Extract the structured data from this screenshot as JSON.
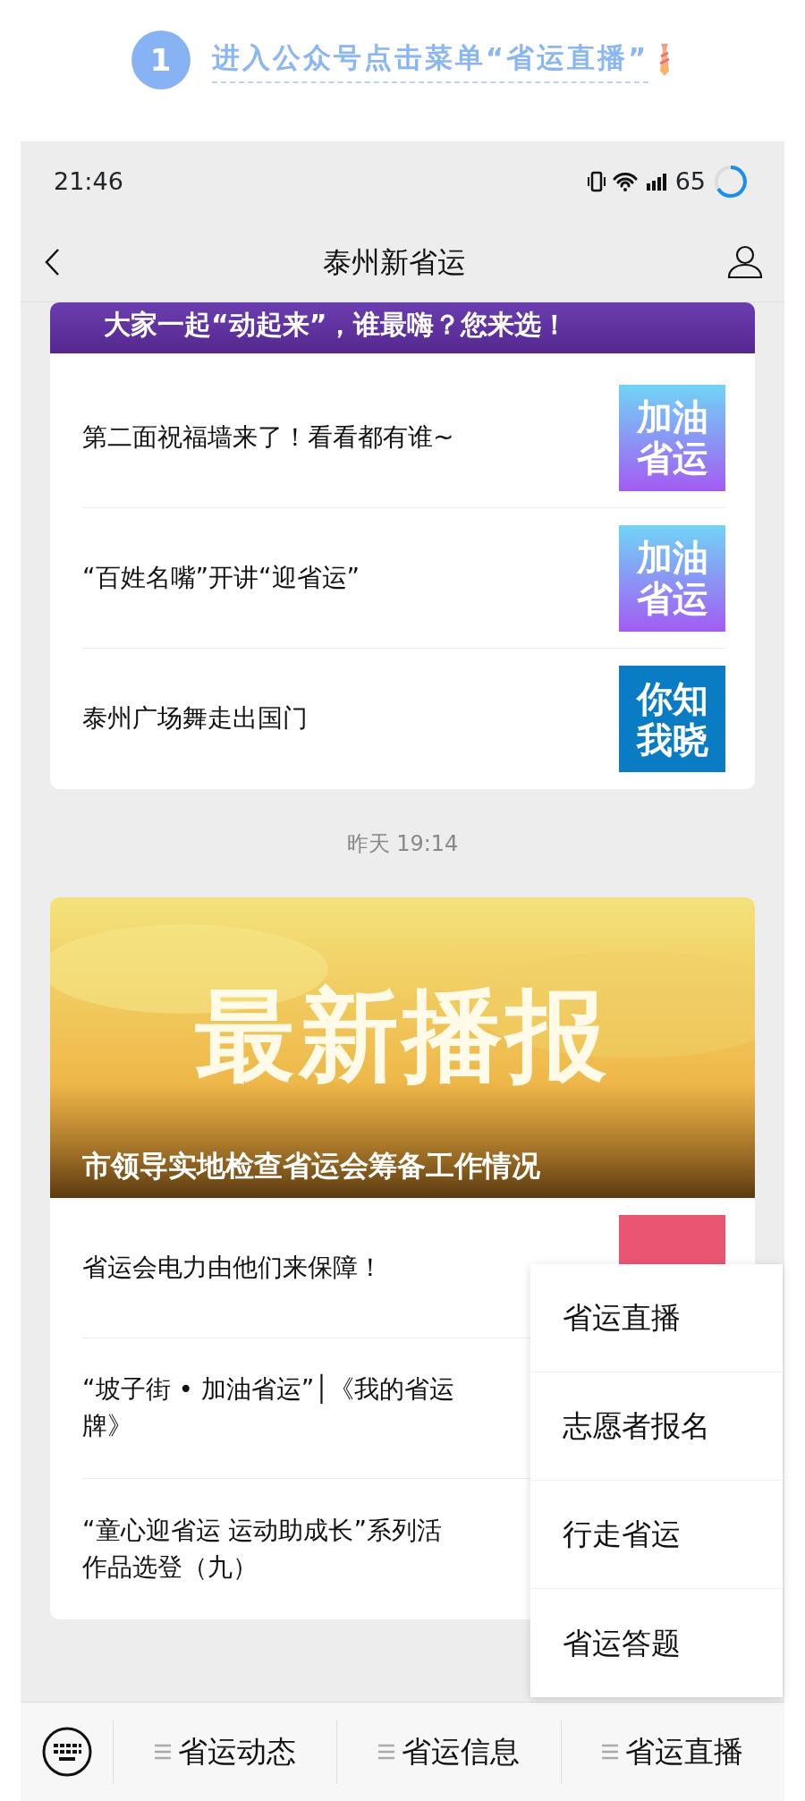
{
  "step": {
    "number": "1",
    "text": "进入公众号点击菜单“省运直播”"
  },
  "status_bar": {
    "time": "21:46",
    "battery": "65"
  },
  "nav": {
    "title": "泰州新省运"
  },
  "feed": [
    {
      "kind": "list",
      "banner_title": "大家一起“动起来”，谁最嗨？您来选！",
      "articles": [
        {
          "title_lines": [
            "第二面祝福墙来了！看看都有谁~"
          ],
          "thumbnail": {
            "kind": "gradient",
            "lines": [
              "加油",
              "省运"
            ]
          }
        },
        {
          "title_lines": [
            "“百姓名嘴”开讲“迎省运”"
          ],
          "thumbnail": {
            "kind": "gradient",
            "lines": [
              "加油",
              "省运"
            ]
          }
        },
        {
          "title_lines": [
            "泰州广场舞走出国门"
          ],
          "thumbnail": {
            "kind": "solid",
            "lines": [
              "你知",
              "我晓"
            ]
          }
        }
      ]
    },
    {
      "kind": "time",
      "text": "昨天 19:14"
    },
    {
      "kind": "cover",
      "headline": "最新播报",
      "cover_title": "市领导实地检查省运会筹备工作情况",
      "articles": [
        {
          "title_lines": [
            "省运会电力由他们来保障！"
          ],
          "thumbnail": {
            "kind": "red"
          }
        },
        {
          "title_lines": [
            "“坡子街 • 加油省运”│《我的省运",
            "牌》"
          ]
        },
        {
          "title_lines": [
            "“童心迎省运 运动助成长”系列活",
            "作品选登（九）"
          ]
        }
      ]
    }
  ],
  "popup_menu": {
    "items": [
      "省运直播",
      "志愿者报名",
      "行走省运",
      "省运答题"
    ]
  },
  "bottom_menu": {
    "items": [
      "省运动态",
      "省运信息",
      "省运直播"
    ]
  }
}
